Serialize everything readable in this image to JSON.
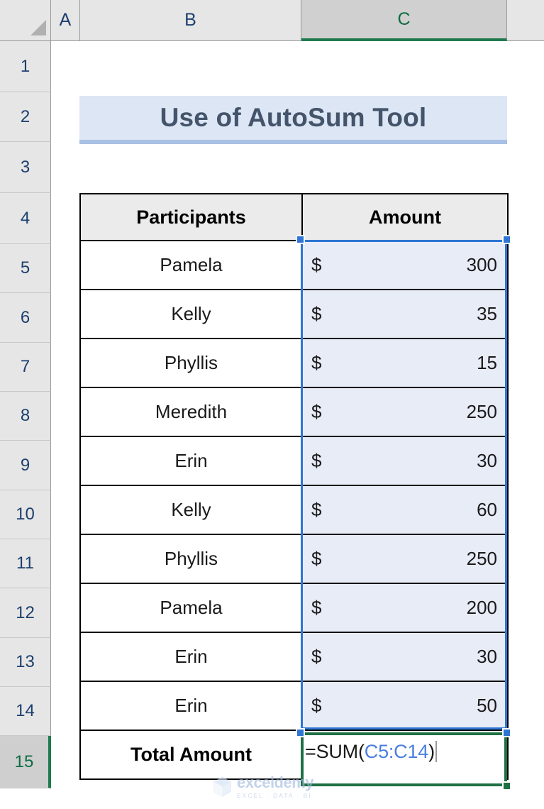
{
  "app": {
    "type": "spreadsheet",
    "select_all_corner": "select-all-triangle"
  },
  "columns": {
    "headers": [
      "A",
      "B",
      "C"
    ],
    "active": "C"
  },
  "rows": {
    "numbers": [
      "1",
      "2",
      "3",
      "4",
      "5",
      "6",
      "7",
      "8",
      "9",
      "10",
      "11",
      "12",
      "13",
      "14",
      "15"
    ],
    "active": "15"
  },
  "title_banner": {
    "text": "Use of AutoSum Tool",
    "fill": "#dce6f5",
    "accent": "#a8c0e4",
    "text_color": "#44546a"
  },
  "table": {
    "headers": [
      "Participants",
      "Amount"
    ],
    "currency_symbol": "$",
    "rows": [
      {
        "participant": "Pamela",
        "amount": "300"
      },
      {
        "participant": "Kelly",
        "amount": "35"
      },
      {
        "participant": "Phyllis",
        "amount": "15"
      },
      {
        "participant": "Meredith",
        "amount": "250"
      },
      {
        "participant": "Erin",
        "amount": "30"
      },
      {
        "participant": "Kelly",
        "amount": "60"
      },
      {
        "participant": "Phyllis",
        "amount": "250"
      },
      {
        "participant": "Pamela",
        "amount": "200"
      },
      {
        "participant": "Erin",
        "amount": "30"
      },
      {
        "participant": "Erin",
        "amount": "50"
      }
    ],
    "total_label": "Total Amount"
  },
  "formula_cell": {
    "cell_ref": "C15",
    "prefix": "=SUM(",
    "range_ref": "C5:C14",
    "suffix": ")",
    "editing": true,
    "border_color": "#1f7044",
    "ref_color": "#4a7ee0"
  },
  "selection": {
    "range": "C5:C14",
    "fill": "#e8ecf7",
    "border_color": "#2e75d4"
  },
  "watermark": {
    "brand": "exceldemy",
    "tagline": "EXCEL · DATA · BI"
  },
  "chart_data": {
    "type": "table",
    "title": "Use of AutoSum Tool",
    "columns": [
      "Participants",
      "Amount"
    ],
    "categories": [
      "Pamela",
      "Kelly",
      "Phyllis",
      "Meredith",
      "Erin",
      "Kelly",
      "Phyllis",
      "Pamela",
      "Erin",
      "Erin"
    ],
    "values": [
      300,
      35,
      15,
      250,
      30,
      60,
      250,
      200,
      30,
      50
    ],
    "total_label": "Total Amount",
    "total_formula": "=SUM(C5:C14)",
    "currency": "$"
  }
}
